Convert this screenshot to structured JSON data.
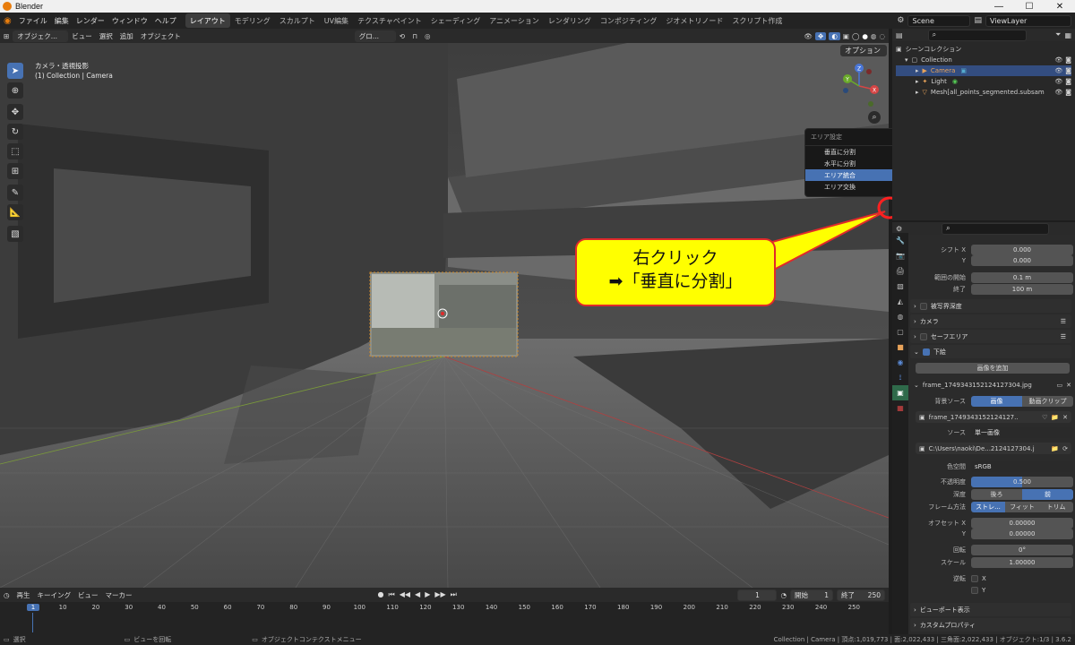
{
  "window": {
    "title": "Blender",
    "minimize": "—",
    "maximize": "☐",
    "close": "✕"
  },
  "topbar": {
    "menus": [
      "ファイル",
      "編集",
      "レンダー",
      "ウィンドウ",
      "ヘルプ"
    ],
    "workspaces": [
      "レイアウト",
      "モデリング",
      "スカルプト",
      "UV編集",
      "テクスチャペイント",
      "シェーディング",
      "アニメーション",
      "レンダリング",
      "コンポジティング",
      "ジオメトリノード",
      "スクリプト作成"
    ],
    "active_workspace": "レイアウト",
    "scene": "Scene",
    "view_layer": "ViewLayer"
  },
  "viewport_header": {
    "mode": "オブジェク...",
    "menus": [
      "ビュー",
      "選択",
      "追加",
      "オブジェクト"
    ],
    "transform": "グロ...",
    "options": "オプション"
  },
  "viewport": {
    "view_name": "カメラ・透視投影",
    "object_info": "(1) Collection | Camera",
    "tools": [
      "select-tool",
      "cursor-tool",
      "move-tool",
      "rotate-tool",
      "scale-tool",
      "transform-tool",
      "annotate-tool",
      "measure-tool",
      "add-cube-tool"
    ],
    "gizmo": {
      "x": "X",
      "y": "Y",
      "z": "Z"
    }
  },
  "context_menu": {
    "title": "エリア設定",
    "items": [
      "垂直に分割",
      "水平に分割",
      "エリア統合",
      "エリア交換"
    ],
    "highlighted": "エリア統合"
  },
  "callout": {
    "line1": "右クリック",
    "line2": "➡「垂直に分割」"
  },
  "outliner": {
    "root": "シーンコレクション",
    "collection": "Collection",
    "items": [
      {
        "name": "Camera",
        "selected": true
      },
      {
        "name": "Light",
        "selected": false
      },
      {
        "name": "Mesh[all_points_segmented.subsam",
        "selected": false
      }
    ]
  },
  "properties": {
    "shift_x_label": "シフト X",
    "shift_x": "0.000",
    "shift_y_label": "Y",
    "shift_y": "0.000",
    "clip_start_label": "範囲の開始",
    "clip_start": "0.1 m",
    "clip_end_label": "終了",
    "clip_end": "100 m",
    "sections": [
      "被写界深度",
      "カメラ",
      "セーフエリア",
      "下絵"
    ],
    "add_image": "画像を追加",
    "frame_name": "frame_1749343152124127304.jpg",
    "bg_source_label": "背景ソース",
    "bg_source_image": "画像",
    "bg_source_clip": "動画クリップ",
    "image_name": "frame_1749343152124127...",
    "source_label": "ソース",
    "source_value": "単一画像",
    "filepath": "C:\\Users\\naoki\\De...2124127304.jpg",
    "colorspace_label": "色空間",
    "colorspace": "sRGB",
    "opacity_label": "不透明度",
    "opacity": "0.500",
    "depth_label": "深度",
    "depth_back": "後ろ",
    "depth_front": "前",
    "frame_method_label": "フレーム方法",
    "frame_methods": [
      "ストレ...",
      "フィット",
      "トリム"
    ],
    "offset_x_label": "オフセット X",
    "offset_x": "0.00000",
    "offset_y_label": "Y",
    "offset_y": "0.00000",
    "rotation_label": "回転",
    "rotation": "0°",
    "scale_label": "スケール",
    "scale": "1.00000",
    "flip_label": "逆転",
    "flip_x": "X",
    "flip_y": "Y",
    "viewport_display": "ビューポート表示",
    "custom_props": "カスタムプロパティ"
  },
  "timeline": {
    "menus": [
      "再生",
      "キーイング",
      "ビュー",
      "マーカー"
    ],
    "current_frame": "1",
    "start_label": "開始",
    "start": "1",
    "end_label": "終了",
    "end": "250",
    "ticks": [
      "1",
      "10",
      "20",
      "30",
      "40",
      "50",
      "60",
      "70",
      "80",
      "90",
      "100",
      "110",
      "120",
      "130",
      "140",
      "150",
      "160",
      "170",
      "180",
      "190",
      "200",
      "210",
      "220",
      "230",
      "240",
      "250"
    ]
  },
  "statusbar": {
    "select": "選択",
    "rotate": "ビューを回転",
    "context_menu": "オブジェクトコンテクストメニュー",
    "stats": "Collection | Camera | 頂点:1,019,773 | 面:2,022,433 | 三角面:2,022,433 | オブジェクト:1/3 | 3.6.2"
  },
  "colors": {
    "accent": "#4772b3",
    "callout_fill": "#ffff00",
    "callout_border": "#e02a2a",
    "highlight_ring": "#ff2020"
  }
}
